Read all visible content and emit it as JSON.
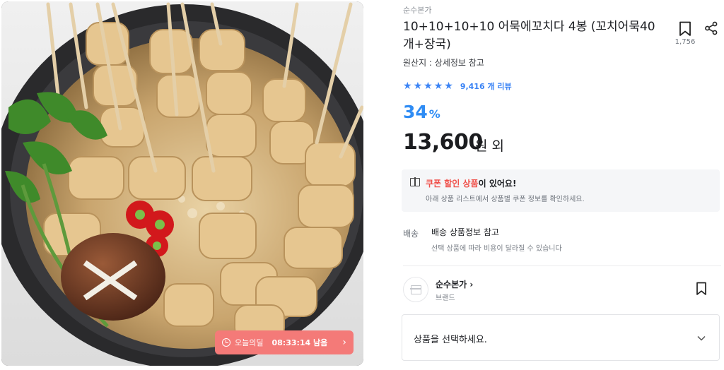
{
  "image": {
    "alt_hint": "",
    "deal_badge": {
      "label": "오늘의딜",
      "timer": "08:33:14 남음",
      "chevron": "›",
      "icon": "clock-icon"
    }
  },
  "product": {
    "brand_top": "순수본가",
    "title": "10+10+10+10 어묵에꼬치다 4봉 (꼬치어묵40개+장국)",
    "bookmark_count": "1,756",
    "origin": "원산지 : 상세정보 참고",
    "rating_stars": 5,
    "review_text": "9,416 개 리뷰",
    "discount_value": "34",
    "discount_unit": "%",
    "price": "13,600",
    "price_unit": "원 외"
  },
  "coupon": {
    "title_highlight": "쿠폰 할인 상품",
    "title_rest": "이 있어요!",
    "subtitle": "아래 상품 리스트에서 상품별 쿠폰 정보를 확인하세요."
  },
  "shipping": {
    "label": "배송",
    "value": "배송 상품정보 참고",
    "note": "선택 상품에 따라 비용이 달라질 수 있습니다"
  },
  "store": {
    "name": "순수본가",
    "chevron": "›",
    "type": "브랜드"
  },
  "options": {
    "placeholder": "상품을 선택하세요."
  },
  "colors": {
    "accent_blue": "#2f8cf4",
    "star_blue": "#3a83f5",
    "deal_red": "#f47a78",
    "coupon_red": "#f0514b"
  }
}
